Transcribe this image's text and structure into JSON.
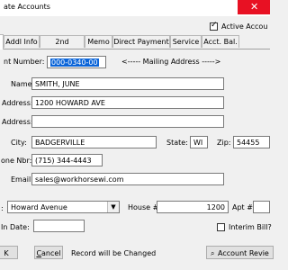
{
  "window": {
    "title": "ate Accounts"
  },
  "active_checkbox": {
    "label": "Active Accou",
    "checked": true
  },
  "tabs": [
    {
      "label": "X",
      "active": true
    },
    {
      "label": "Addl Info"
    },
    {
      "label": "2nd Contact"
    },
    {
      "label": "Memo"
    },
    {
      "label": "Direct Payment"
    },
    {
      "label": "Service"
    },
    {
      "label": "Acct. Bal."
    }
  ],
  "form": {
    "account_number_label": "nt Number:",
    "account_number_value": "000-0340-00",
    "mailing_address_caption": "<----- Mailing Address ----->",
    "name_label": "Name:",
    "name_value": "SMITH, JUNE",
    "address1_label": "Address:",
    "address1_value": "1200 HOWARD AVE",
    "address2_label": "Address:",
    "address2_value": "",
    "city_label": "City:",
    "city_value": "BADGERVILLE",
    "state_label": "State:",
    "state_value": "WI",
    "zip_label": "Zip:",
    "zip_value": "54455",
    "phone_label": "one Nbr:",
    "phone_value": "(715) 344-4443",
    "email_label": "Email:",
    "email_value": "sales@workhorsewi.com",
    "street_label": ":",
    "street_value": "Howard Avenue",
    "house_label": "House #",
    "house_value": "1200",
    "apt_label": "Apt #",
    "apt_value": "",
    "in_date_label": "In Date:",
    "in_date_value": "",
    "interim_bill_label": "Interim Bill?",
    "interim_bill_checked": false
  },
  "footer": {
    "ok_label": "K",
    "cancel_label_u": "C",
    "cancel_label_rest": "ancel",
    "status_text": "Record will be Changed",
    "account_review_label": "Account Revie"
  }
}
